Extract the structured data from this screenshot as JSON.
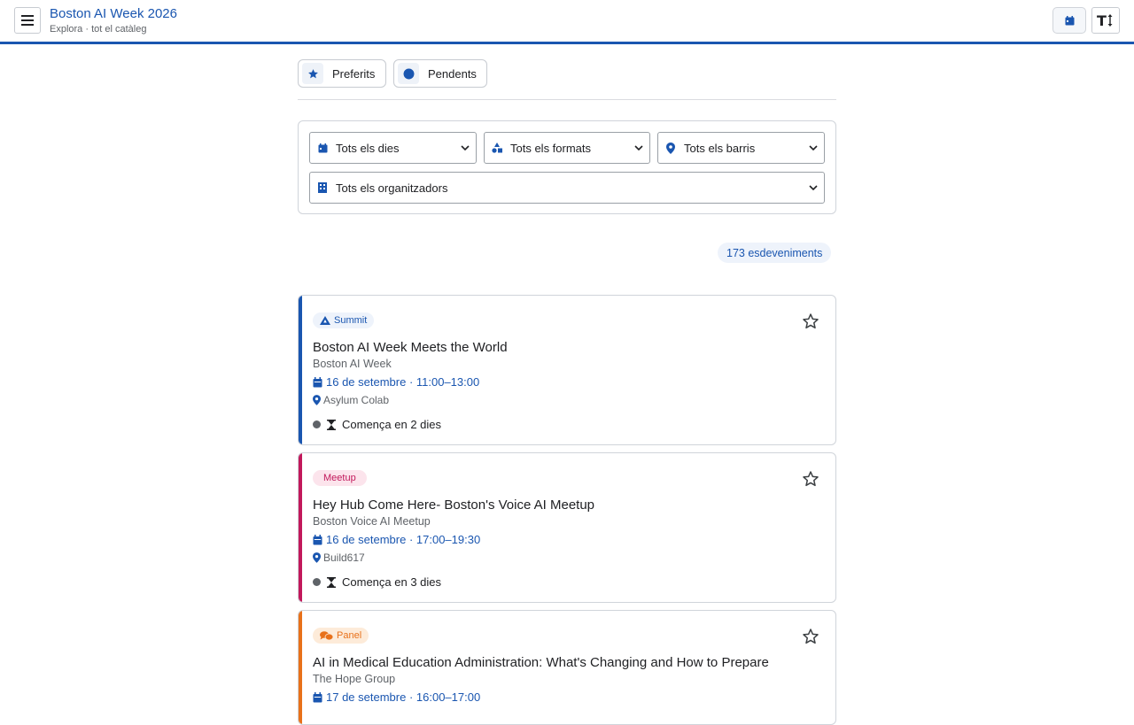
{
  "header": {
    "title": "Boston AI Week 2026",
    "subtitle": "Explora · tot el catàleg",
    "menu_icon": "hamburger-icon",
    "calendar_icon": "calendar-icon",
    "text_size_icon": "text-size-icon",
    "accent_color": "#1a56b0"
  },
  "tabs": [
    {
      "label": "Preferits",
      "icon": "star-icon"
    },
    {
      "label": "Pendents",
      "icon": "circle-icon"
    }
  ],
  "filters": {
    "day": "Tots els dies",
    "format": "Tots els formats",
    "neighborhood": "Tots els barris",
    "organizer": "Tots els organitzadors"
  },
  "results_count": "173 esdeveniments",
  "events": [
    {
      "badge": "Summit",
      "badge_color": "#1a56b0",
      "accent_color": "#1a56b0",
      "title": "Boston AI Week Meets the World",
      "organizer": "Boston AI Week",
      "datetime": "16 de setembre · 11:00–13:00",
      "venue": "Asylum Colab",
      "status": "Comença en 2 dies"
    },
    {
      "badge": "Meetup",
      "badge_color": "#c2185b",
      "accent_color": "#c2185b",
      "title": "Hey Hub Come Here- Boston's Voice AI Meetup",
      "organizer": "Boston Voice AI Meetup",
      "datetime": "16 de setembre · 17:00–19:30",
      "venue": "Build617",
      "status": "Comença en 3 dies"
    },
    {
      "badge": "Panel",
      "badge_color": "#e8711a",
      "accent_color": "#e8711a",
      "title": "AI in Medical Education Administration: What's Changing and How to Prepare",
      "organizer": "The Hope Group",
      "datetime": "17 de setembre · 16:00–17:00",
      "venue": "",
      "status": ""
    }
  ]
}
